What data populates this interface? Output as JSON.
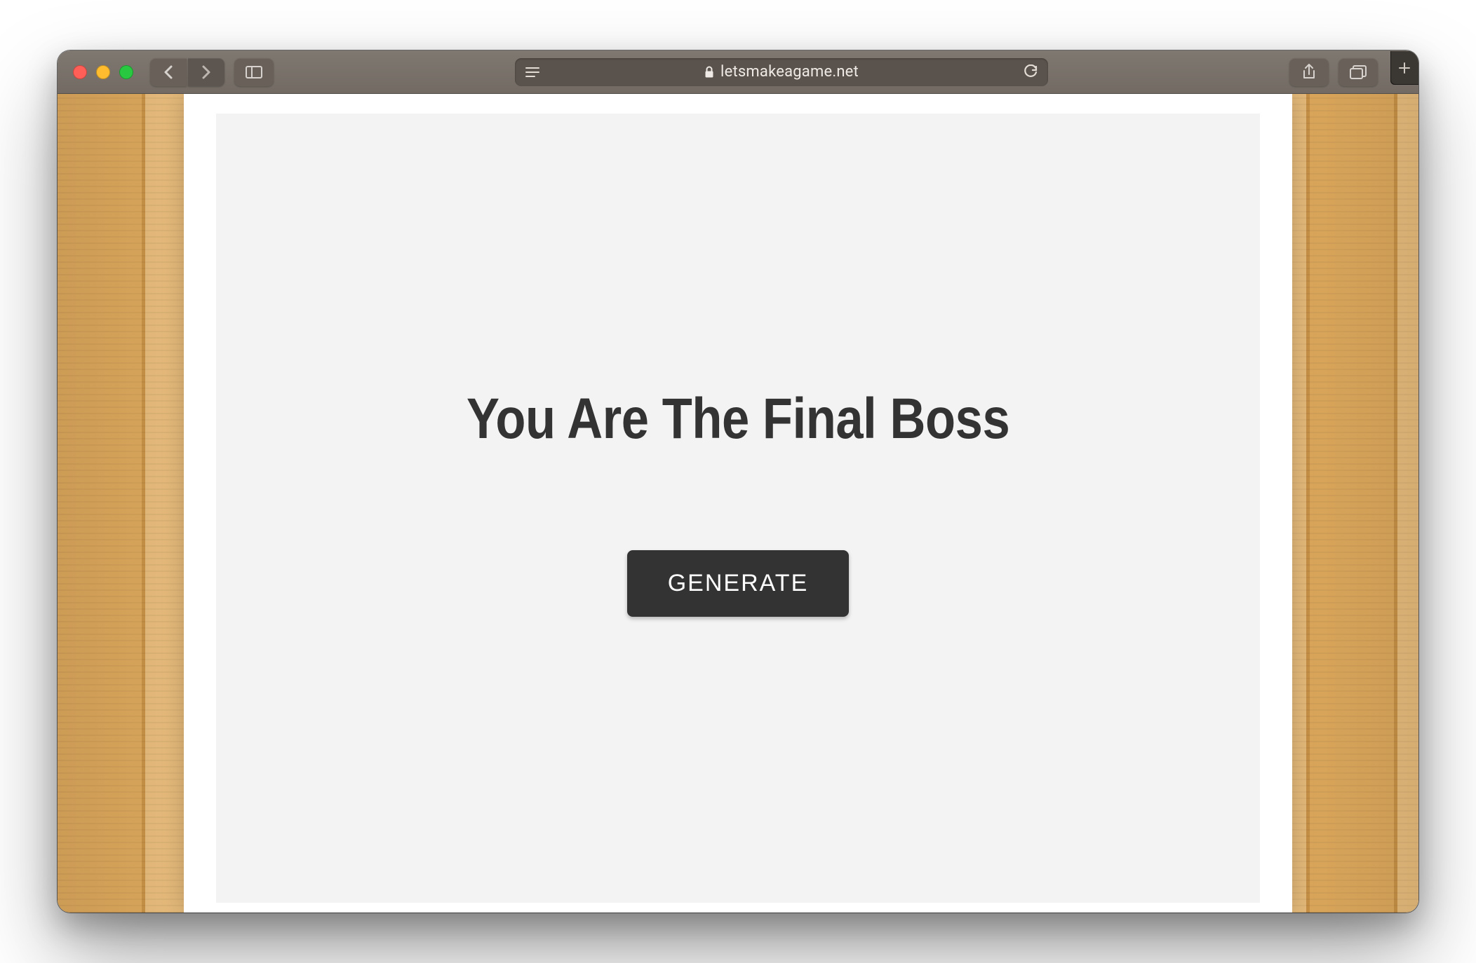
{
  "browser": {
    "url_host": "letsmakeagame.net"
  },
  "page": {
    "title": "You Are The Final Boss",
    "generate_label": "GENERATE"
  }
}
